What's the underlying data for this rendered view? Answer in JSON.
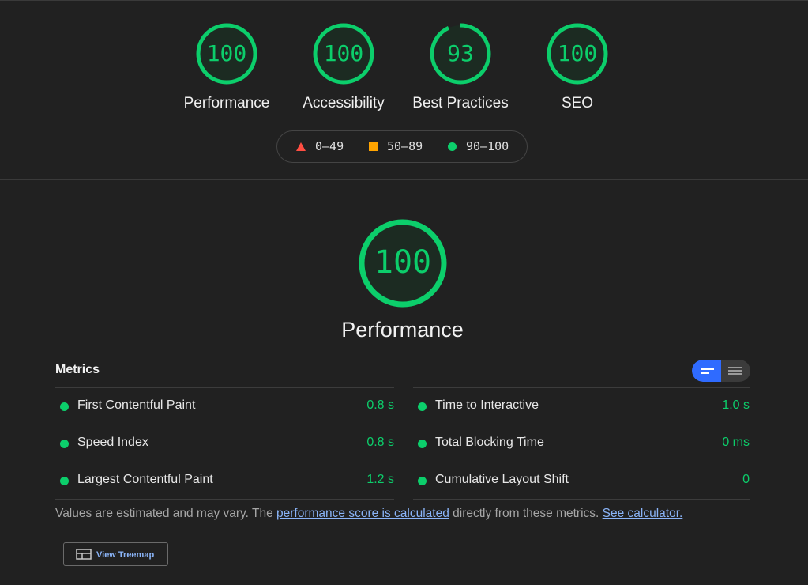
{
  "summary": {
    "gauges": [
      {
        "score": "100",
        "label": "Performance"
      },
      {
        "score": "100",
        "label": "Accessibility"
      },
      {
        "score": "93",
        "label": "Best Practices",
        "fraction": 0.93
      },
      {
        "score": "100",
        "label": "SEO"
      }
    ]
  },
  "legend": {
    "fail": "0–49",
    "average": "50–89",
    "pass": "90–100"
  },
  "category": {
    "score": "100",
    "title": "Performance"
  },
  "metrics": {
    "title": "Metrics",
    "left": [
      {
        "name": "First Contentful Paint",
        "value": "0.8 s"
      },
      {
        "name": "Speed Index",
        "value": "0.8 s"
      },
      {
        "name": "Largest Contentful Paint",
        "value": "1.2 s"
      }
    ],
    "right": [
      {
        "name": "Time to Interactive",
        "value": "1.0 s"
      },
      {
        "name": "Total Blocking Time",
        "value": "0 ms"
      },
      {
        "name": "Cumulative Layout Shift",
        "value": "0"
      }
    ]
  },
  "note": {
    "prefix": "Values are estimated and may vary. The ",
    "link1": "performance score is calculated",
    "middle": " directly from these metrics.",
    "link2": "See calculator."
  },
  "treemap": {
    "label": "View Treemap"
  },
  "colors": {
    "pass": "#0cce6b",
    "average": "#ffa400",
    "fail": "#ff4e42",
    "accent": "#2f6bff",
    "link": "#8ab4f8"
  }
}
